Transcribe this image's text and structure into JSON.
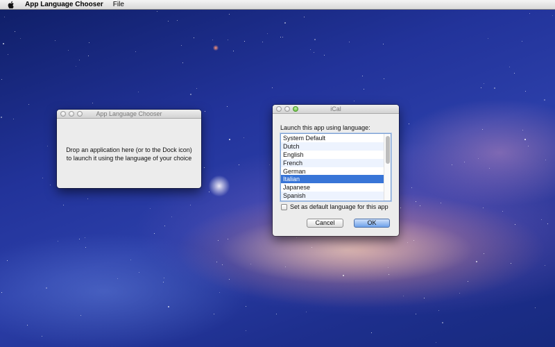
{
  "menubar": {
    "apple_icon": "apple-icon",
    "app_name": "App Language Chooser",
    "items": [
      "File"
    ]
  },
  "main_window": {
    "title": "App Language Chooser",
    "drop_line1": "Drop an application here (or to the Dock icon)",
    "drop_line2": "to launch it using the language of your choice"
  },
  "dialog": {
    "title": "iCal",
    "prompt": "Launch this app using language:",
    "languages": [
      "System Default",
      "Dutch",
      "English",
      "French",
      "German",
      "Italian",
      "Japanese",
      "Spanish"
    ],
    "selected": "Italian",
    "default_checkbox_label": "Set as default language for this app",
    "default_checked": false,
    "cancel_label": "Cancel",
    "ok_label": "OK"
  },
  "colors": {
    "selection": "#3875d7",
    "menubar": "#e6e6e6",
    "window_bg": "#ececec"
  }
}
